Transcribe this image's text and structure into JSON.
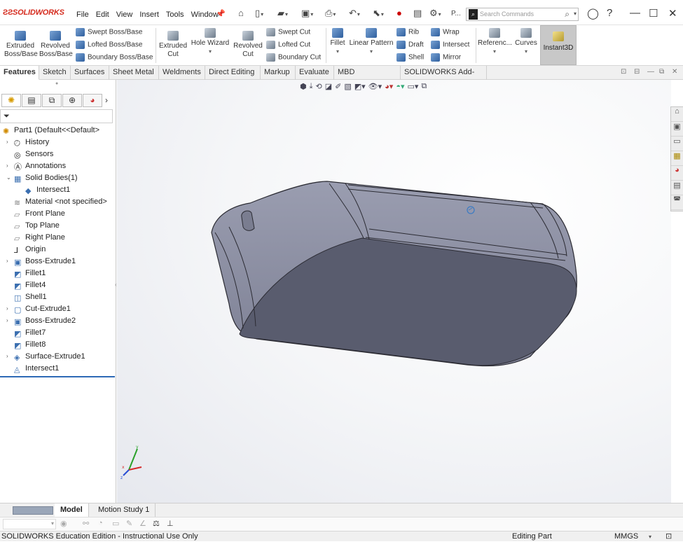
{
  "app": {
    "logo_text": "SOLIDWORKS"
  },
  "menu": [
    "File",
    "Edit",
    "View",
    "Insert",
    "Tools",
    "Window"
  ],
  "search": {
    "placeholder": "Search Commands"
  },
  "quick_access": {
    "p_label": "P..."
  },
  "commands": {
    "extruded_boss": "Extruded Boss/Base",
    "revolved_boss": "Revolved Boss/Base",
    "swept_boss": "Swept Boss/Base",
    "lofted_boss": "Lofted Boss/Base",
    "boundary_boss": "Boundary Boss/Base",
    "extruded_cut": "Extruded Cut",
    "hole_wizard": "Hole Wizard",
    "revolved_cut": "Revolved Cut",
    "swept_cut": "Swept Cut",
    "lofted_cut": "Lofted Cut",
    "boundary_cut": "Boundary Cut",
    "fillet": "Fillet",
    "linear_pattern": "Linear Pattern",
    "rib": "Rib",
    "draft": "Draft",
    "shell": "Shell",
    "wrap": "Wrap",
    "intersect": "Intersect",
    "mirror": "Mirror",
    "reference": "Referenc...",
    "curves": "Curves",
    "instant3d": "Instant3D"
  },
  "tabs": [
    "Features",
    "Sketch",
    "Surfaces",
    "Sheet Metal",
    "Weldments",
    "Direct Editing",
    "Markup",
    "Evaluate",
    "MBD Dimensions",
    "SOLIDWORKS Add-Ins"
  ],
  "tree": {
    "root": "Part1  (Default<<Default>",
    "items": [
      {
        "label": "History",
        "expand": "›"
      },
      {
        "label": "Sensors",
        "expand": ""
      },
      {
        "label": "Annotations",
        "expand": "›"
      },
      {
        "label": "Solid Bodies(1)",
        "expand": "⌄"
      },
      {
        "label": "Intersect1",
        "expand": ""
      },
      {
        "label": "Material <not specified>",
        "expand": ""
      },
      {
        "label": "Front Plane",
        "expand": ""
      },
      {
        "label": "Top Plane",
        "expand": ""
      },
      {
        "label": "Right Plane",
        "expand": ""
      },
      {
        "label": "Origin",
        "expand": ""
      },
      {
        "label": "Boss-Extrude1",
        "expand": "›"
      },
      {
        "label": "Fillet1",
        "expand": ""
      },
      {
        "label": "Fillet4",
        "expand": ""
      },
      {
        "label": "Shell1",
        "expand": ""
      },
      {
        "label": "Cut-Extrude1",
        "expand": "›"
      },
      {
        "label": "Boss-Extrude2",
        "expand": "›"
      },
      {
        "label": "Fillet7",
        "expand": ""
      },
      {
        "label": "Fillet8",
        "expand": ""
      },
      {
        "label": "Surface-Extrude1",
        "expand": "›"
      },
      {
        "label": "Intersect1",
        "expand": ""
      }
    ]
  },
  "triad": {
    "x": "x",
    "y": "y",
    "z": "z"
  },
  "bottom_tabs": [
    "Model",
    "Motion Study 1"
  ],
  "status": {
    "left": "SOLIDWORKS Education Edition - Instructional Use Only",
    "mode": "Editing Part",
    "units": "MMGS"
  },
  "colors": {
    "brand": "#d52b1e",
    "accent": "#2d69b5",
    "model_body": "#7c7f93",
    "model_bottom": "#5b5e70"
  }
}
